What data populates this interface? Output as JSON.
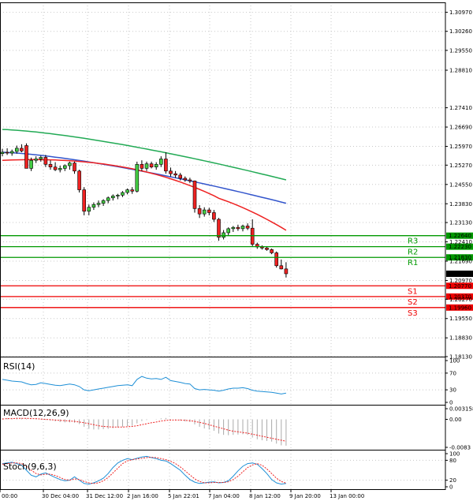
{
  "chart_data": [
    {
      "type": "candlestick",
      "name": "price",
      "yticks": [
        "1.30970",
        "1.30260",
        "1.29550",
        "1.28810",
        "1.27410",
        "1.26690",
        "1.25970",
        "1.25270",
        "1.24550",
        "1.23830",
        "1.23130",
        "1.22410",
        "1.21690",
        "1.20970",
        "1.20270",
        "1.19550",
        "1.18830",
        "1.18130"
      ],
      "ylim": [
        1.1813,
        1.3134
      ],
      "xticks": [
        "00:00",
        "30 Dec 04:00",
        "31 Dec 12:00",
        "2 Jan 16:00",
        "5 Jan 22:01",
        "7 Jan 04:00",
        "8 Jan 12:00",
        "9 Jan 20:00",
        "13 Jan 00:00"
      ],
      "candles": [
        [
          1.257,
          1.2588,
          1.256,
          1.2575
        ],
        [
          1.2575,
          1.259,
          1.2565,
          1.2572
        ],
        [
          1.2572,
          1.2585,
          1.2562,
          1.2578
        ],
        [
          1.2578,
          1.26,
          1.257,
          1.259
        ],
        [
          1.259,
          1.2605,
          1.2575,
          1.258
        ],
        [
          1.26,
          1.2608,
          1.253,
          1.2515
        ],
        [
          1.2515,
          1.2555,
          1.2505,
          1.2545
        ],
        [
          1.2545,
          1.256,
          1.2535,
          1.255
        ],
        [
          1.255,
          1.2562,
          1.254,
          1.2556
        ],
        [
          1.2556,
          1.2565,
          1.252,
          1.253
        ],
        [
          1.253,
          1.2545,
          1.251,
          1.252
        ],
        [
          1.252,
          1.2538,
          1.2505,
          1.251
        ],
        [
          1.251,
          1.2525,
          1.25,
          1.2515
        ],
        [
          1.2515,
          1.253,
          1.2505,
          1.2525
        ],
        [
          1.2525,
          1.254,
          1.251,
          1.2535
        ],
        [
          1.2535,
          1.254,
          1.2495,
          1.2505
        ],
        [
          1.2505,
          1.251,
          1.2425,
          1.2435
        ],
        [
          1.2435,
          1.2445,
          1.234,
          1.2355
        ],
        [
          1.2355,
          1.238,
          1.234,
          1.237
        ],
        [
          1.237,
          1.2388,
          1.236,
          1.238
        ],
        [
          1.238,
          1.2395,
          1.237,
          1.2385
        ],
        [
          1.2385,
          1.24,
          1.2375,
          1.2395
        ],
        [
          1.2395,
          1.241,
          1.2385,
          1.2405
        ],
        [
          1.2405,
          1.2418,
          1.2395,
          1.2412
        ],
        [
          1.2412,
          1.242,
          1.24,
          1.2415
        ],
        [
          1.2415,
          1.243,
          1.2408,
          1.2425
        ],
        [
          1.2425,
          1.244,
          1.2418,
          1.2435
        ],
        [
          1.2435,
          1.2445,
          1.242,
          1.243
        ],
        [
          1.243,
          1.254,
          1.2425,
          1.253
        ],
        [
          1.253,
          1.2545,
          1.2505,
          1.2515
        ],
        [
          1.2515,
          1.254,
          1.2505,
          1.2532
        ],
        [
          1.2532,
          1.254,
          1.2515,
          1.252
        ],
        [
          1.252,
          1.2538,
          1.251,
          1.253
        ],
        [
          1.253,
          1.256,
          1.252,
          1.255
        ],
        [
          1.255,
          1.2575,
          1.2495,
          1.2505
        ],
        [
          1.2505,
          1.2518,
          1.2485,
          1.2495
        ],
        [
          1.2495,
          1.2505,
          1.248,
          1.249
        ],
        [
          1.249,
          1.2498,
          1.247,
          1.2478
        ],
        [
          1.2478,
          1.2485,
          1.2465,
          1.2472
        ],
        [
          1.2472,
          1.248,
          1.246,
          1.2468
        ],
        [
          1.2468,
          1.247,
          1.235,
          1.2365
        ],
        [
          1.2365,
          1.2378,
          1.233,
          1.2345
        ],
        [
          1.2345,
          1.237,
          1.2335,
          1.236
        ],
        [
          1.236,
          1.2368,
          1.234,
          1.235
        ],
        [
          1.235,
          1.236,
          1.2315,
          1.2325
        ],
        [
          1.2325,
          1.233,
          1.2245,
          1.2258
        ],
        [
          1.2258,
          1.2285,
          1.225,
          1.2275
        ],
        [
          1.2275,
          1.2295,
          1.2265,
          1.229
        ],
        [
          1.229,
          1.23,
          1.2278,
          1.2295
        ],
        [
          1.2295,
          1.2305,
          1.2282,
          1.229
        ],
        [
          1.229,
          1.2305,
          1.228,
          1.23
        ],
        [
          1.23,
          1.231,
          1.2285,
          1.2292
        ],
        [
          1.2292,
          1.2325,
          1.2225,
          1.2232
        ],
        [
          1.2232,
          1.2238,
          1.2215,
          1.2222
        ],
        [
          1.2222,
          1.2228,
          1.2212,
          1.2218
        ],
        [
          1.2218,
          1.2222,
          1.2208,
          1.2212
        ],
        [
          1.2212,
          1.2216,
          1.2195,
          1.22
        ],
        [
          1.22,
          1.2205,
          1.2145,
          1.2152
        ],
        [
          1.2152,
          1.2175,
          1.2138,
          1.214
        ],
        [
          1.214,
          1.2165,
          1.2108,
          1.2122
        ]
      ],
      "moving_averages": [
        {
          "color": "#22aa55",
          "start": 1.266,
          "end": 1.2472
        },
        {
          "color": "#3355cc",
          "start": 1.2575,
          "end": 1.2385
        },
        {
          "color": "#ee2222",
          "start": 1.2545,
          "end": 1.2265
        }
      ],
      "levels": [
        {
          "label": "R3",
          "value": 1.2264,
          "tag": "1.22640",
          "color": "#009900"
        },
        {
          "label": "R2",
          "value": 1.2223,
          "tag": "1.22230",
          "color": "#009900"
        },
        {
          "label": "R1",
          "value": 1.2183,
          "tag": "1.21830",
          "color": "#009900"
        },
        {
          "label": "S1",
          "value": 1.2077,
          "tag": "1.20770",
          "color": "#ee0000"
        },
        {
          "label": "S2",
          "value": 1.2037,
          "tag": "1.20370",
          "color": "#ee0000"
        },
        {
          "label": "S3",
          "value": 1.1996,
          "tag": "1.19960",
          "color": "#ee0000"
        }
      ],
      "current_price": {
        "value": 1.2122,
        "tag": "1.21216"
      }
    },
    {
      "type": "line",
      "name": "RSI(14)",
      "yticks": [
        "100",
        "70",
        "30",
        "0"
      ],
      "ylim": [
        0,
        100
      ],
      "values": [
        55,
        53,
        51,
        50,
        49,
        45,
        42,
        43,
        47,
        45,
        43,
        41,
        40,
        42,
        44,
        42,
        38,
        30,
        28,
        30,
        32,
        34,
        36,
        38,
        40,
        41,
        42,
        40,
        55,
        62,
        58,
        56,
        57,
        55,
        60,
        52,
        50,
        48,
        45,
        44,
        33,
        30,
        31,
        30,
        29,
        27,
        29,
        32,
        34,
        34,
        35,
        33,
        29,
        27,
        26,
        25,
        24,
        22,
        20,
        22
      ]
    },
    {
      "type": "histogram",
      "name": "MACD(12,26,9)",
      "yticks": [
        "0.003158",
        "0.00",
        "-0.0083"
      ],
      "ylim": [
        -0.0083,
        0.003158
      ],
      "values": [
        0.0003,
        0.0004,
        0.0004,
        0.0005,
        0.0004,
        0.0002,
        0.0,
        -0.0001,
        -0.0001,
        -0.0002,
        -0.0004,
        -0.0006,
        -0.0008,
        -0.0009,
        -0.0009,
        -0.001,
        -0.0014,
        -0.0022,
        -0.0028,
        -0.003,
        -0.003,
        -0.0029,
        -0.0028,
        -0.0026,
        -0.0024,
        -0.0022,
        -0.002,
        -0.0019,
        -0.0012,
        -0.0005,
        -0.0002,
        0.0,
        0.0001,
        0.0003,
        0.0004,
        0.0001,
        -0.0001,
        -0.0003,
        -0.0006,
        -0.0008,
        -0.0015,
        -0.0022,
        -0.0027,
        -0.003,
        -0.0034,
        -0.0042,
        -0.0046,
        -0.0047,
        -0.0046,
        -0.0045,
        -0.0044,
        -0.0046,
        -0.0054,
        -0.0059,
        -0.0062,
        -0.0064,
        -0.0066,
        -0.0072,
        -0.0077,
        -0.0078
      ],
      "signal": [
        0.0001,
        0.0002,
        0.0002,
        0.0003,
        0.0003,
        0.0003,
        0.0002,
        0.0002,
        0.0001,
        0.0,
        -0.0001,
        -0.0002,
        -0.0003,
        -0.0004,
        -0.0005,
        -0.0006,
        -0.0008,
        -0.001,
        -0.0013,
        -0.0016,
        -0.0019,
        -0.0021,
        -0.0022,
        -0.0023,
        -0.0023,
        -0.0023,
        -0.0022,
        -0.0021,
        -0.0019,
        -0.0016,
        -0.0013,
        -0.001,
        -0.0008,
        -0.0005,
        -0.0003,
        -0.0002,
        -0.0002,
        -0.0002,
        -0.0003,
        -0.0004,
        -0.0006,
        -0.0009,
        -0.0012,
        -0.0016,
        -0.002,
        -0.0024,
        -0.0028,
        -0.0032,
        -0.0035,
        -0.0037,
        -0.0039,
        -0.0041,
        -0.0044,
        -0.0047,
        -0.005,
        -0.0053,
        -0.0056,
        -0.0059,
        -0.0062,
        -0.0065
      ]
    },
    {
      "type": "line",
      "name": "Stoch(9,6,3)",
      "yticks": [
        "100",
        "80",
        "20",
        "0"
      ],
      "ylim": [
        0,
        100
      ],
      "main": [
        70,
        72,
        74,
        70,
        65,
        50,
        35,
        30,
        38,
        42,
        35,
        28,
        22,
        18,
        20,
        30,
        20,
        10,
        8,
        12,
        18,
        26,
        40,
        58,
        72,
        80,
        85,
        82,
        86,
        90,
        92,
        88,
        85,
        80,
        78,
        70,
        60,
        50,
        35,
        22,
        14,
        10,
        12,
        14,
        15,
        12,
        13,
        18,
        32,
        48,
        62,
        70,
        72,
        68,
        55,
        40,
        22,
        12,
        8,
        10
      ],
      "signal": [
        68,
        70,
        72,
        72,
        70,
        62,
        50,
        40,
        36,
        38,
        38,
        34,
        28,
        22,
        20,
        24,
        22,
        16,
        12,
        10,
        12,
        18,
        28,
        42,
        56,
        70,
        78,
        82,
        84,
        86,
        88,
        89,
        88,
        85,
        82,
        77,
        70,
        60,
        48,
        36,
        24,
        16,
        12,
        12,
        13,
        13,
        13,
        15,
        22,
        32,
        45,
        58,
        66,
        70,
        65,
        54,
        40,
        26,
        16,
        11
      ]
    }
  ]
}
